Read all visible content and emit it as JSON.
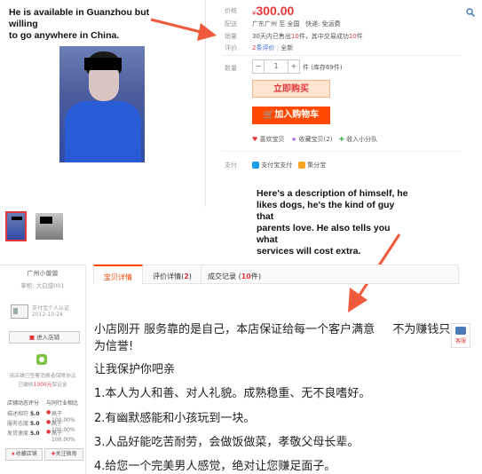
{
  "annotations": {
    "left_top": [
      "He is available in Guanzhou but willing",
      "to go anywhere in China."
    ],
    "right_mid": [
      "Here's a description of himself, he",
      "likes dogs, he's the kind of guy that",
      "parents love. He also tells you what",
      "services will cost extra."
    ]
  },
  "product": {
    "price_label": "价格",
    "currency": "¥",
    "price": "300.00",
    "ship_label": "配送",
    "ship_from": "广东广州 至 全国",
    "ship_fee": "快递: 免运费",
    "sales_label": "销量",
    "sales_prefix": "30天内已售出",
    "sales_count": "10",
    "sales_mid": "件，其中交易成功",
    "sales_success": "10",
    "sales_suffix": "件",
    "rating_label": "评价",
    "rating_count": "2",
    "rating_text": "条评价",
    "rating_sep": "|",
    "rating_all": "全新",
    "qty_label": "数量",
    "qty_minus": "−",
    "qty_value": "1",
    "qty_plus": "+",
    "qty_stock": "件 (库存69件)",
    "buy_now": "立即购买",
    "add_cart": "加入购物车",
    "like": "喜欢宝贝",
    "fav": "收藏宝贝(2)",
    "share": "收入小分队",
    "pay_label": "支付",
    "alipay": "支付宝支付",
    "jifenbao": "集分宝"
  },
  "seller": {
    "name": "广州小兽兽",
    "id_line": "掌柜: 大白甜001",
    "verify": "支付宝个人认证",
    "date": "2012-10-24",
    "enter_shop": "进入店铺",
    "guarantee_1": "该店铺已签署消费者保障协议",
    "guarantee_2a": "已缴纳",
    "guarantee_amt": "1000元",
    "guarantee_2b": "保证金",
    "stats_head_l": "店铺动态评分",
    "stats_head_r": "与同行业相比",
    "stats": [
      {
        "label": "描述相符",
        "score": "5.0",
        "compare": "高于100.00%"
      },
      {
        "label": "服务态度",
        "score": "5.0",
        "compare": "高于100.00%"
      },
      {
        "label": "发货速度",
        "score": "5.0",
        "compare": "高于100.00%"
      }
    ],
    "fav_shop": "收藏店铺",
    "follow": "关注微淘"
  },
  "tabs": {
    "detail": "宝贝详情",
    "reviews_prefix": "评价详情(",
    "reviews_count": "2",
    "reviews_suffix": ")",
    "records_prefix": "成交记录 (",
    "records_count": "10",
    "records_suffix": "件)"
  },
  "description": {
    "line1": "小店刚开 服务靠的是自己，本店保证给每一个客户满意",
    "line1b": "不为赚钱只",
    "line1c": "为信誉!",
    "line2": "让我保护你吧亲",
    "line3": "1.本人为人和善、对人礼貌。成熟稳重、无不良嗜好。",
    "line4": "2.有幽默感能和小孩玩到一块。",
    "line5": "3.人品好能吃苦耐劳，会做饭做菜，孝敬父母长辈。",
    "line6": "4.给您一个完美男人感觉，绝对让您赚足面子。"
  },
  "side": {
    "kefu": "客服"
  },
  "colors": {
    "price": "#e4393c",
    "buy_bg": "#ffe4d0",
    "cart_bg": "#ff4a00",
    "arrow": "#f05a3c",
    "tab_accent": "#ff4400"
  }
}
